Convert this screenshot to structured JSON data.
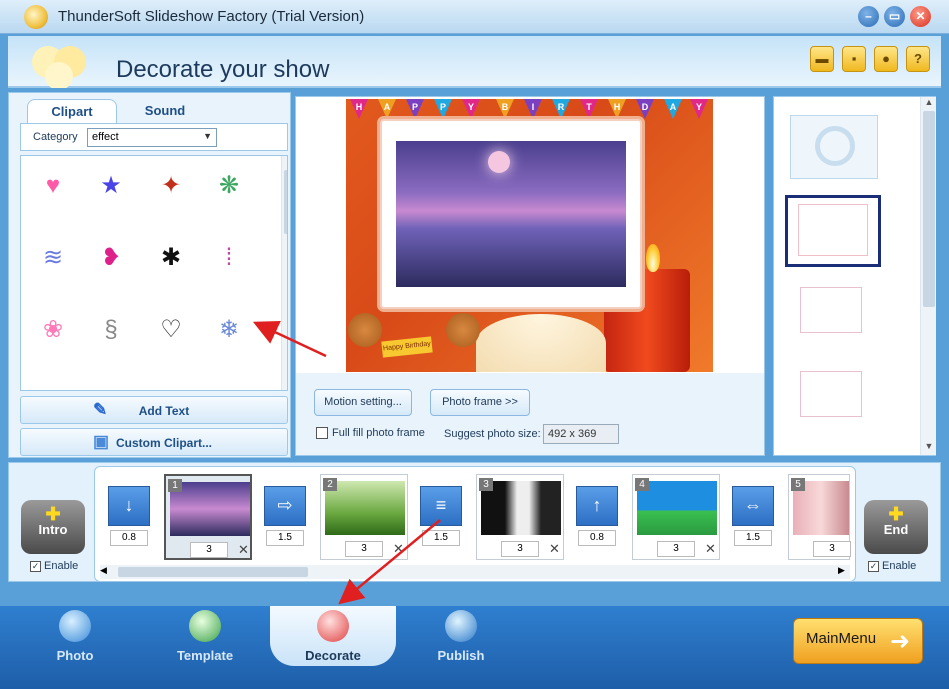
{
  "window": {
    "title": "ThunderSoft Slideshow Factory (Trial Version)"
  },
  "header": {
    "heading": "Decorate your show",
    "toolbar_icons": [
      "folder-icon",
      "save-icon",
      "user-icon",
      "help-icon"
    ]
  },
  "left_panel": {
    "tabs": [
      {
        "label": "Clipart",
        "active": true
      },
      {
        "label": "Sound",
        "active": false
      }
    ],
    "category_label": "Category",
    "category_value": "effect",
    "clipart_icons": [
      "heart",
      "stars",
      "butterfly",
      "confetti",
      "ribbon",
      "lips",
      "ant",
      "drops",
      "petals",
      "outline-shape",
      "hearts-outline",
      "snowflake"
    ],
    "add_text_label": "Add Text",
    "custom_clipart_label": "Custom Clipart..."
  },
  "preview": {
    "banner_letters": [
      "H",
      "A",
      "P",
      "P",
      "Y",
      "B",
      "I",
      "R",
      "T",
      "H",
      "D",
      "A",
      "Y"
    ],
    "sign_text": "Happy Birthday",
    "motion_button": "Motion setting...",
    "photo_frame_button": "Photo frame >>",
    "full_fill_label": "Full fill photo frame",
    "full_fill_checked": false,
    "suggest_label": "Suggest photo size:",
    "suggest_value": "492 x 369"
  },
  "timeline": {
    "intro_label": "Intro",
    "end_label": "End",
    "enable_label": "Enable",
    "items": [
      {
        "kind": "transition",
        "value": "0.8"
      },
      {
        "kind": "slide",
        "num": "1",
        "duration": "3",
        "selected": true
      },
      {
        "kind": "transition",
        "value": "1.5"
      },
      {
        "kind": "slide",
        "num": "2",
        "duration": "3",
        "selected": false
      },
      {
        "kind": "transition",
        "value": "1.5"
      },
      {
        "kind": "slide",
        "num": "3",
        "duration": "3",
        "selected": false
      },
      {
        "kind": "transition",
        "value": "0.8"
      },
      {
        "kind": "slide",
        "num": "4",
        "duration": "3",
        "selected": false
      },
      {
        "kind": "transition",
        "value": "1.5"
      },
      {
        "kind": "slide",
        "num": "5",
        "duration": "3",
        "selected": false
      }
    ]
  },
  "bottom_nav": {
    "items": [
      {
        "label": "Photo"
      },
      {
        "label": "Template"
      },
      {
        "label": "Decorate",
        "active": true
      },
      {
        "label": "Publish"
      }
    ],
    "main_menu_label": "MainMenu"
  }
}
